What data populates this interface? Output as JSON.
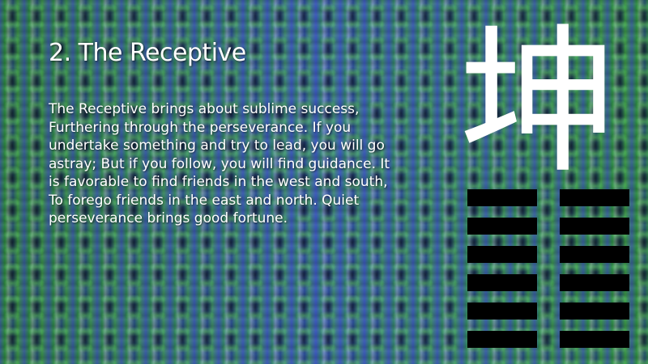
{
  "slide": {
    "title": "2. The Receptive",
    "body": "The Receptive brings about sublime success, Furthering through the perseverance. If you undertake something and try to lead, you will go astray; But if you follow, you will find guidance. It is favorable to find friends in the west and south, To forego friends in the east and north. Quiet perseverance brings good fortune.",
    "glyph": "坤",
    "hexagram": {
      "lines": [
        "broken",
        "broken",
        "broken",
        "broken",
        "broken",
        "broken"
      ],
      "color": "#000000"
    },
    "colors": {
      "text": "#ffffff",
      "background": "#2f5a3c"
    }
  }
}
